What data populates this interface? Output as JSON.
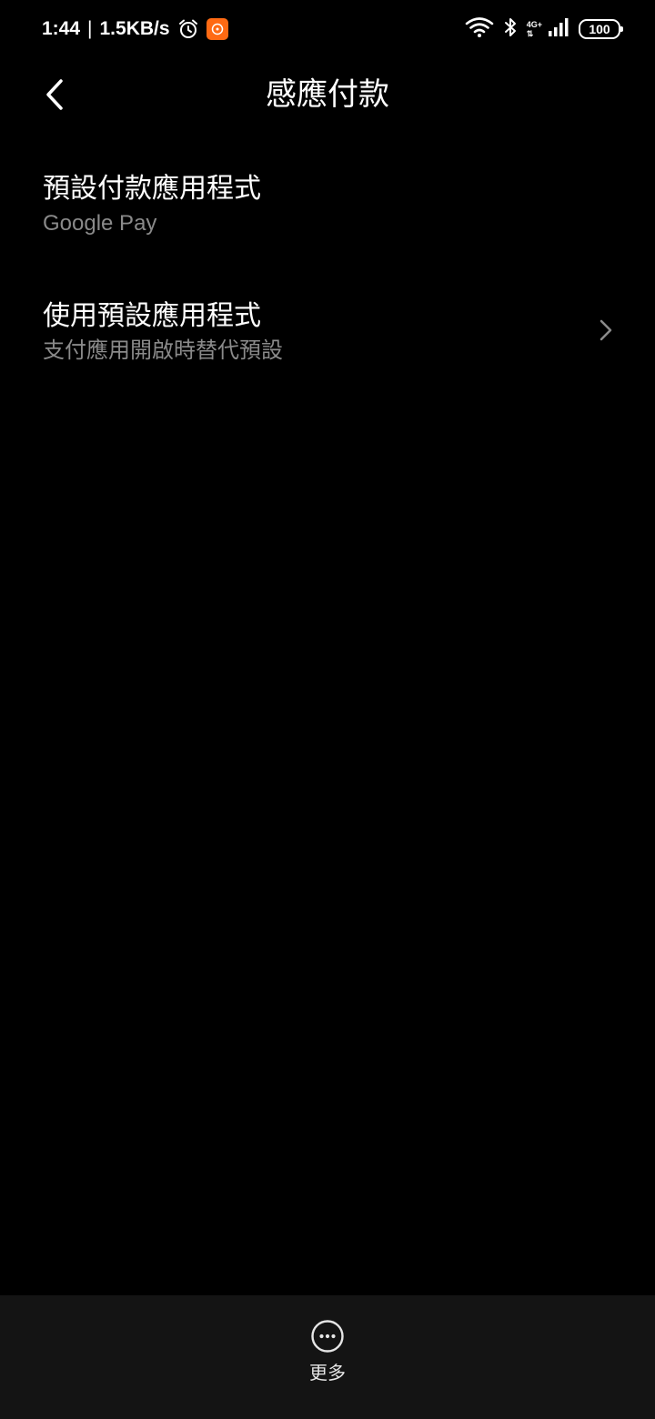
{
  "status_bar": {
    "time": "1:44",
    "separator": "|",
    "speed": "1.5KB/s",
    "network_top": "4G+",
    "network_bottom": "⇅",
    "battery": "100"
  },
  "header": {
    "title": "感應付款"
  },
  "settings": {
    "items": [
      {
        "title": "預設付款應用程式",
        "subtitle": "Google Pay"
      },
      {
        "title": "使用預設應用程式",
        "subtitle": "支付應用開啟時替代預設"
      }
    ]
  },
  "bottom_bar": {
    "more_label": "更多"
  },
  "colors": {
    "background": "#000000",
    "text_primary": "#ffffff",
    "text_secondary": "#8a8a8a",
    "bottom_bar": "#141414",
    "notification_accent": "#ff6a13"
  }
}
